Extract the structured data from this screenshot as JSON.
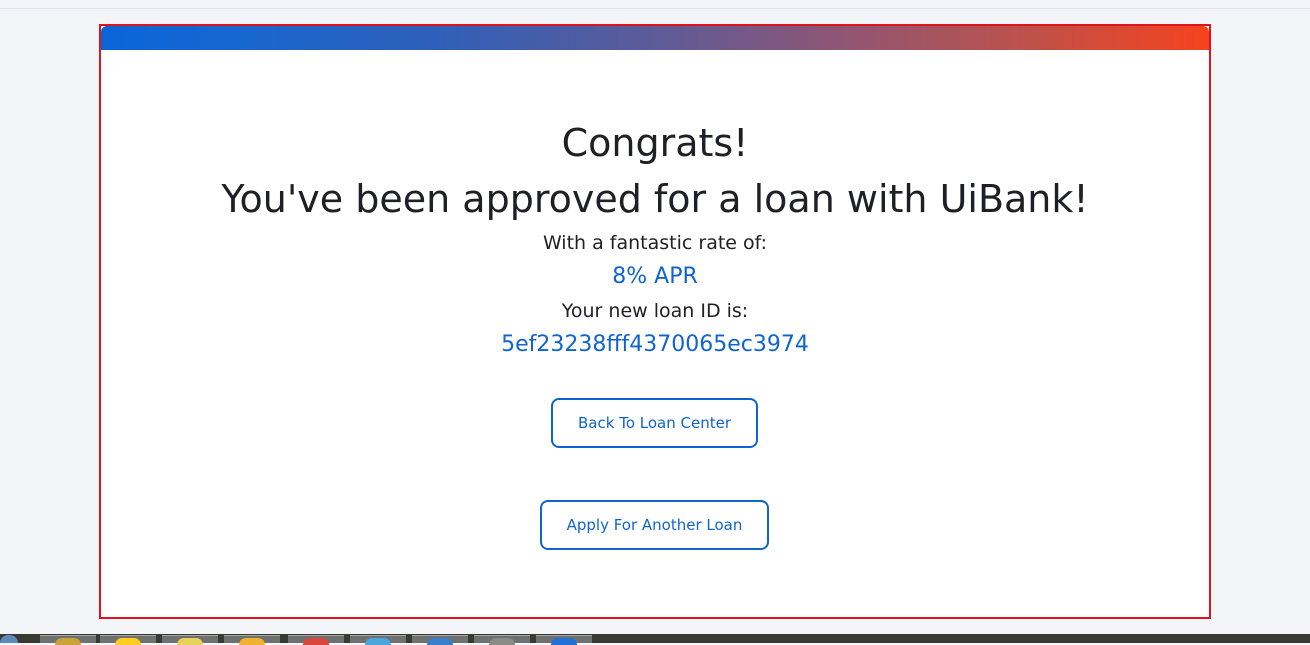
{
  "card": {
    "gradient_colors": [
      "#0a65d8",
      "#5d5b98",
      "#f5431d"
    ],
    "border_color": "#e0141c"
  },
  "message": {
    "congrats": "Congrats!",
    "approved": "You've been approved for a loan with UiBank!",
    "rate_label": "With a fantastic rate of:",
    "rate_value": "8% APR",
    "loan_id_label": "Your new loan ID is:",
    "loan_id_value": "5ef23238fff4370065ec3974"
  },
  "actions": {
    "back_label": "Back To Loan Center",
    "apply_label": "Apply For Another Loan"
  },
  "colors": {
    "accent": "#1064d0",
    "text": "#1f1f26",
    "page_bg": "#f4f5f9"
  },
  "taskbar": {
    "items": [
      {
        "icon": "start-orb-icon"
      },
      {
        "icon": "folder-icon"
      },
      {
        "icon": "notes-icon"
      },
      {
        "icon": "chrome-icon"
      },
      {
        "icon": "ie-icon"
      },
      {
        "icon": "app-icon"
      },
      {
        "icon": "app-icon"
      },
      {
        "icon": "window-icon"
      }
    ]
  }
}
